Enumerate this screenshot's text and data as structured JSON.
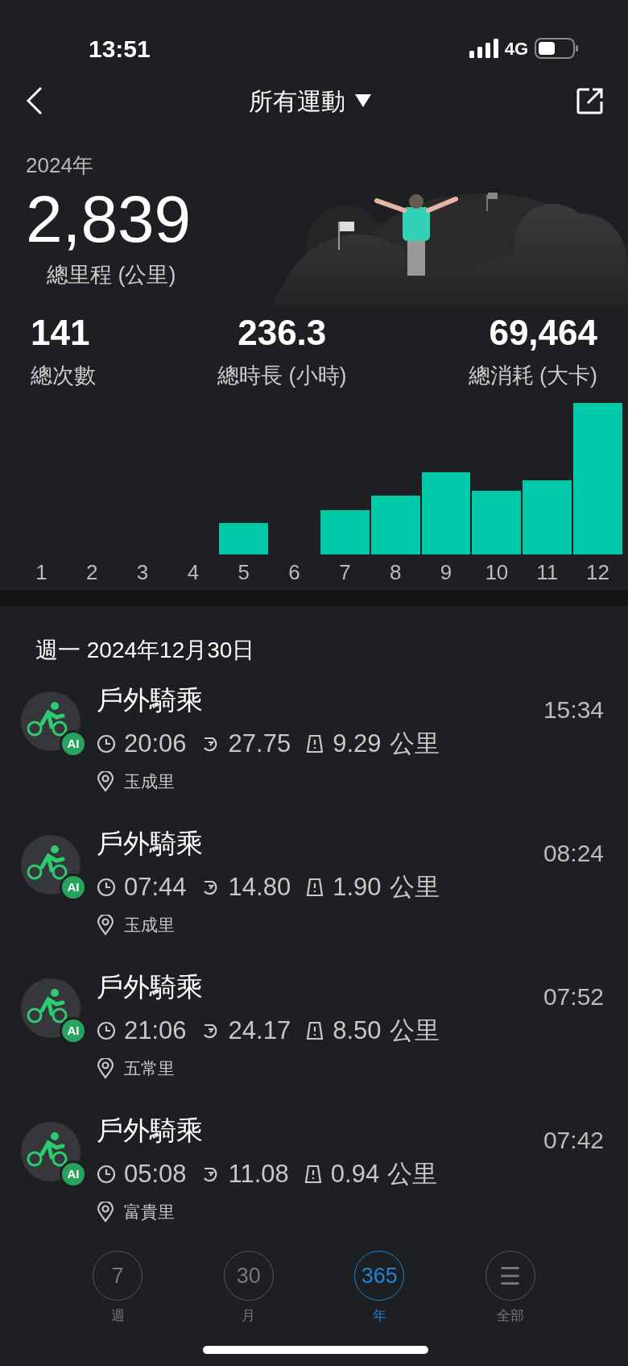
{
  "status_bar": {
    "time": "13:51",
    "network": "4G"
  },
  "header": {
    "title": "所有運動"
  },
  "summary": {
    "year": "2024年",
    "distance": "2,839",
    "distance_label": "總里程 (公里)"
  },
  "stats": [
    {
      "value": "141",
      "label": "總次數"
    },
    {
      "value": "236.3",
      "label": "總時長 (小時)"
    },
    {
      "value": "69,464",
      "label": "總消耗 (大卡)"
    }
  ],
  "months": [
    "1",
    "2",
    "3",
    "4",
    "5",
    "6",
    "7",
    "8",
    "9",
    "10",
    "11",
    "12"
  ],
  "date_header": "週一 2024年12月30日",
  "activities": [
    {
      "title": "戶外騎乘",
      "badge": "AI",
      "time": "15:34",
      "duration": "20:06",
      "speed": "27.75",
      "distance": "9.29",
      "unit": "公里",
      "location": "玉成里"
    },
    {
      "title": "戶外騎乘",
      "badge": "AI",
      "time": "08:24",
      "duration": "07:44",
      "speed": "14.80",
      "distance": "1.90",
      "unit": "公里",
      "location": "玉成里"
    },
    {
      "title": "戶外騎乘",
      "badge": "AI",
      "time": "07:52",
      "duration": "21:06",
      "speed": "24.17",
      "distance": "8.50",
      "unit": "公里",
      "location": "五常里"
    },
    {
      "title": "戶外騎乘",
      "badge": "AI",
      "time": "07:42",
      "duration": "05:08",
      "speed": "11.08",
      "distance": "0.94",
      "unit": "公里",
      "location": "富貴里"
    }
  ],
  "bottom_tabs": [
    {
      "kind": "number",
      "value": "7",
      "label": "週",
      "selected": false
    },
    {
      "kind": "number",
      "value": "30",
      "label": "月",
      "selected": false
    },
    {
      "kind": "number",
      "value": "365",
      "label": "年",
      "selected": true
    },
    {
      "kind": "menu",
      "value": "☰",
      "label": "全部",
      "selected": false
    }
  ]
}
